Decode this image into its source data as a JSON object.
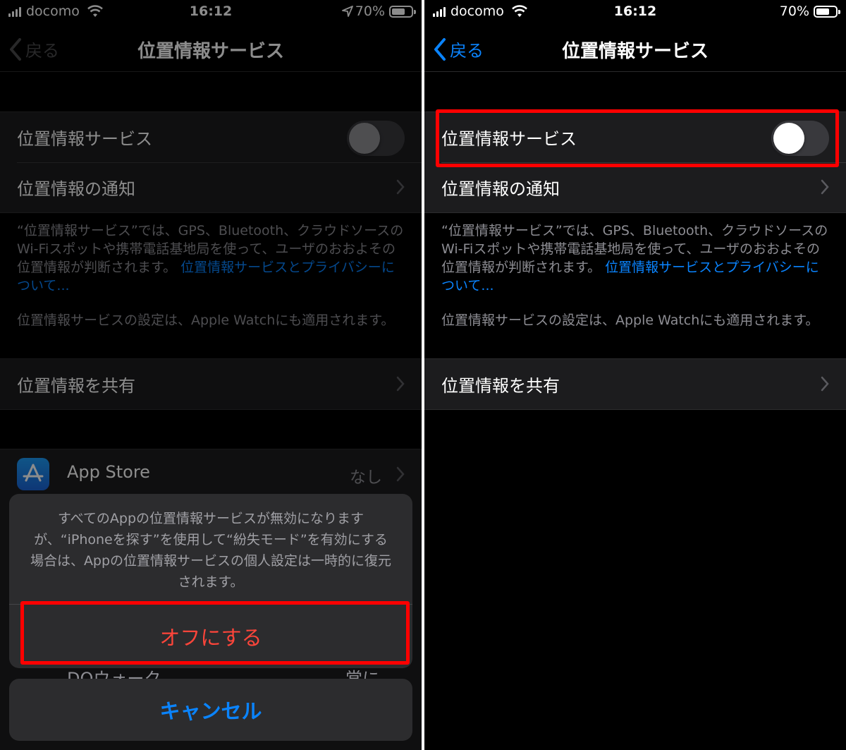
{
  "status": {
    "carrier": "docomo",
    "time": "16:12",
    "battery": "70%"
  },
  "nav": {
    "back": "戻る",
    "title": "位置情報サービス"
  },
  "settings": {
    "location_services": "位置情報サービス",
    "location_alerts": "位置情報の通知",
    "footer_text": "“位置情報サービス”では、GPS、Bluetooth、クラウドソースのWi-Fiスポットや携帯電話基地局を使って、ユーザのおおよその位置情報が判断されます。",
    "footer_link": "位置情報サービスとプライバシーについて...",
    "watch_note": "位置情報サービスの設定は、Apple Watchにも適用されます。",
    "share_location": "位置情報を共有"
  },
  "apps": {
    "app_store": {
      "name": "App Store",
      "value": "なし"
    },
    "dq_walk": {
      "name": "DQウォーク",
      "value": "常に"
    }
  },
  "sheet": {
    "message": "すべてのAppの位置情報サービスが無効になりますが、“iPhoneを探す”を使用して“紛失モード”を有効にする場合は、Appの位置情報サービスの個人設定は一時的に復元されます。",
    "turn_off": "オフにする",
    "cancel": "キャンセル"
  },
  "colors": {
    "link_blue": "#0a84ff",
    "destructive_red": "#ff453a",
    "highlight_red": "#ff0000",
    "cell_bg": "#1c1c1e"
  },
  "toggle_state": {
    "left": "off",
    "right": "off"
  }
}
